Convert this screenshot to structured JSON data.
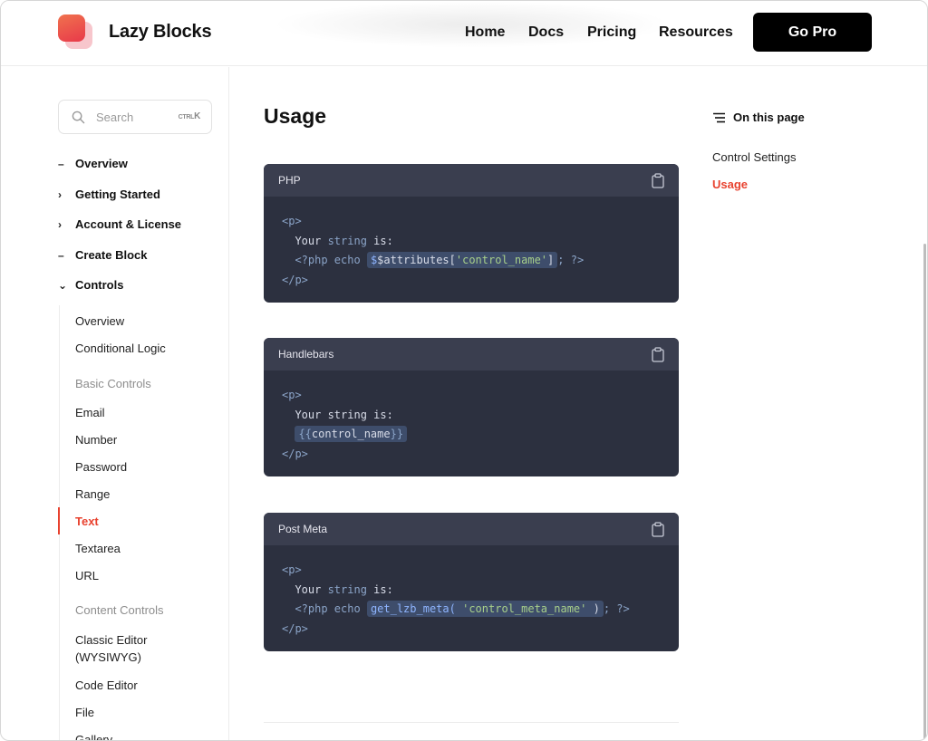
{
  "header": {
    "brand": "Lazy Blocks",
    "nav": [
      "Home",
      "Docs",
      "Pricing",
      "Resources"
    ],
    "cta": "Go Pro"
  },
  "sidebar": {
    "search_placeholder": "Search",
    "search_shortcut_mod": "CTRL",
    "search_shortcut_key": "K",
    "sections": [
      {
        "label": "Overview",
        "marker": "–"
      },
      {
        "label": "Getting Started",
        "marker": "›"
      },
      {
        "label": "Account & License",
        "marker": "›"
      },
      {
        "label": "Create Block",
        "marker": "–"
      },
      {
        "label": "Controls",
        "marker": "⌄"
      }
    ],
    "controls_items": [
      "Overview",
      "Conditional Logic",
      "Basic Controls",
      "Email",
      "Number",
      "Password",
      "Range",
      "Text",
      "Textarea",
      "URL",
      "Content Controls",
      "Classic Editor",
      "(WYSIWYG)",
      "Code Editor",
      "File",
      "Gallery"
    ]
  },
  "main": {
    "title": "Usage",
    "code_blocks": [
      {
        "title": "PHP",
        "l1": "<p>",
        "l2a": "Your ",
        "l2b": "string",
        "l2c": " is:",
        "l3a": "<?php echo ",
        "l3b": "$attributes[",
        "l3c": "'control_name'",
        "l3d": "]",
        "l3e": "; ?>",
        "l4": "</p>"
      },
      {
        "title": "Handlebars",
        "l1": "<p>",
        "l2a": "Your ",
        "l2b": "string",
        "l2c": " is:",
        "l3a": "{{",
        "l3b": "control_name",
        "l3c": "}}",
        "l4": "</p>"
      },
      {
        "title": "Post Meta",
        "l1": "<p>",
        "l2a": "Your ",
        "l2b": "string",
        "l2c": " is:",
        "l3a": "<?php echo ",
        "l3b": "get_lzb_meta( ",
        "l3c": "'control_meta_name'",
        "l3d": " )",
        "l3e": "; ?>",
        "l4": "</p>"
      }
    ]
  },
  "toc": {
    "heading": "On this page",
    "items": [
      "Control Settings",
      "Usage"
    ],
    "active": "Usage"
  },
  "colors": {
    "accent": "#e8422f",
    "code_bg": "#2c303f",
    "code_bar": "#3a3e4f"
  }
}
